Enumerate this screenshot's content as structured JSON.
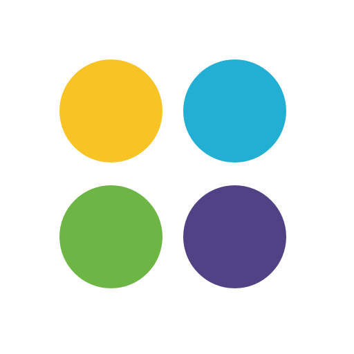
{
  "logo": {
    "dots": [
      {
        "name": "yellow-dot",
        "color": "#F8C325"
      },
      {
        "name": "blue-dot",
        "color": "#23AFD3"
      },
      {
        "name": "green-dot",
        "color": "#6DB545"
      },
      {
        "name": "purple-dot",
        "color": "#514185"
      }
    ]
  }
}
